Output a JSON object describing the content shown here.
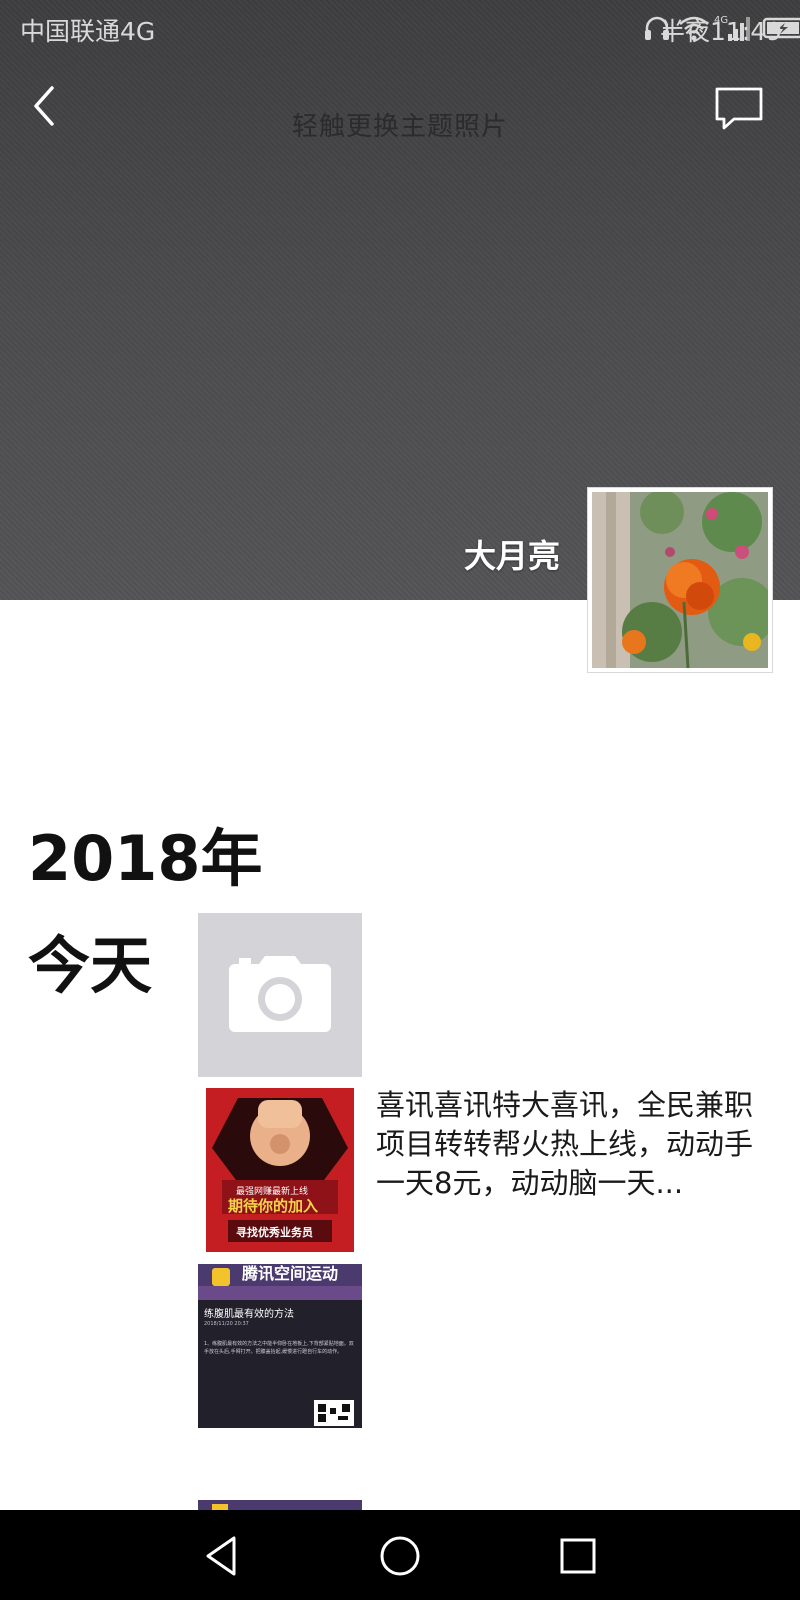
{
  "status_bar": {
    "carrier": "中国联通4G",
    "network_badge": "4G",
    "time": "半夜11:49",
    "icons": [
      "headphones-icon",
      "wifi-icon",
      "signal-icon",
      "battery-charging-icon"
    ]
  },
  "header": {
    "cover_hint": "轻触更换主题照片",
    "back_icon": "chevron-left-icon",
    "message_icon": "message-icon"
  },
  "profile": {
    "username": "大月亮"
  },
  "feed": {
    "year": "2018年",
    "day_label": "今天",
    "camera_icon": "camera-icon",
    "posts": [
      {
        "text": "喜讯喜讯特大喜讯，全民兼职项目转转帮火热上线，动动手一天8元，动动脑一天...",
        "image_lines": [
          "最强网赚最新上线",
          "期待你的加入",
          "寻找优秀业务员"
        ]
      },
      {
        "banner": "腾讯空间运动",
        "title": "练腹肌最有效的方法",
        "date": "2018/11/20 20:37",
        "body": "1、练腹肌最有效的方法之中能半仰卧在地板上,下背部紧贴地面。双手放在头后,手臂打开。把膝盖抬起,缓慢进行蹬自行车的动作。"
      }
    ]
  },
  "nav_bar": {
    "icons": [
      "back-triangle-icon",
      "home-circle-icon",
      "recents-square-icon"
    ]
  }
}
